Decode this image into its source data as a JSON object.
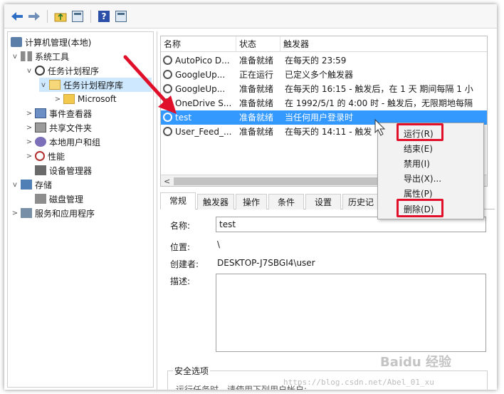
{
  "tree": {
    "items": [
      {
        "label": "计算机管理(本地)",
        "icon": "computer-management-icon"
      },
      {
        "label": "系统工具",
        "icon": "tools-icon"
      },
      {
        "label": "任务计划程序",
        "icon": "clock-icon"
      },
      {
        "label": "任务计划程序库",
        "icon": "folder-open-icon"
      },
      {
        "label": "Microsoft",
        "icon": "folder-icon"
      },
      {
        "label": "事件查看器",
        "icon": "event-viewer-icon"
      },
      {
        "label": "共享文件夹",
        "icon": "shared-folder-icon"
      },
      {
        "label": "本地用户和组",
        "icon": "users-icon"
      },
      {
        "label": "性能",
        "icon": "performance-icon"
      },
      {
        "label": "设备管理器",
        "icon": "device-manager-icon"
      },
      {
        "label": "存储",
        "icon": "storage-icon"
      },
      {
        "label": "磁盘管理",
        "icon": "disk-icon"
      },
      {
        "label": "服务和应用程序",
        "icon": "services-icon"
      }
    ]
  },
  "task_list": {
    "headers": {
      "name": "名称",
      "status": "状态",
      "trigger": "触发器"
    },
    "rows": [
      {
        "name": "AutoPico D...",
        "status": "准备就绪",
        "trigger": "在每天的 23:59"
      },
      {
        "name": "GoogleUp...",
        "status": "正在运行",
        "trigger": "已定义多个触发器"
      },
      {
        "name": "GoogleUp...",
        "status": "准备就绪",
        "trigger": "在每天的 16:15 - 触发后，在 1 天 期间每隔 1 小"
      },
      {
        "name": "OneDrive S...",
        "status": "准备就绪",
        "trigger": "在 1992/5/1 的 4:00 时 - 触发后，无限期地每隔"
      },
      {
        "name": "test",
        "status": "准备就绪",
        "trigger": "当任何用户登录时"
      },
      {
        "name": "User_Feed_...",
        "status": "准备就绪",
        "trigger": "在每天的 14:11 - 触发"
      }
    ],
    "selected_index": 4
  },
  "tabs": [
    "常规",
    "触发器",
    "操作",
    "条件",
    "设置",
    "历史记"
  ],
  "properties": {
    "name_label": "名称:",
    "name_value": "test",
    "location_label": "位置:",
    "location_value": "\\",
    "author_label": "创建者:",
    "author_value": "DESKTOP-J7SBGI4\\user",
    "description_label": "描述:",
    "security_title": "安全选项",
    "security_text": "运行任务时，请使用下列用户帐户:"
  },
  "context_menu": {
    "items": [
      "运行(R)",
      "结束(E)",
      "禁用(I)",
      "导出(X)...",
      "属性(P)",
      "删除(D)"
    ],
    "highlighted": [
      "运行(R)",
      "删除(D)"
    ]
  },
  "watermarks": {
    "baidu": "Baidu 经验",
    "site": "https://blog.csdn.net/Abel_01_xu"
  },
  "colors": {
    "selection": "#3399ff",
    "highlight_red": "#e0102a",
    "arrow_red": "#e0102a"
  }
}
